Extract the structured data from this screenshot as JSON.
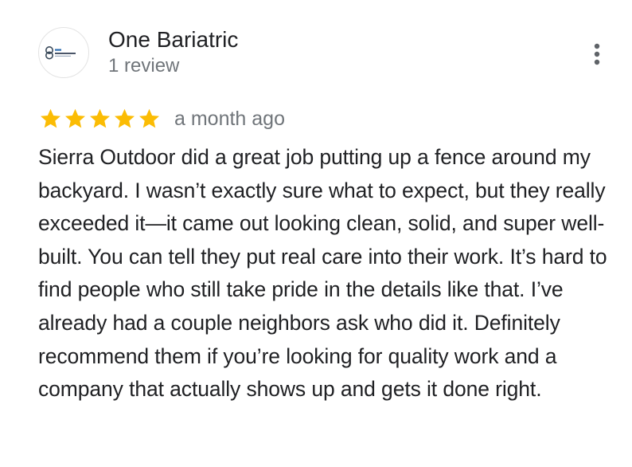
{
  "reviewer": {
    "name": "One Bariatric",
    "review_count": "1 review",
    "avatar_logo_text": "ONE BARIATRIC"
  },
  "rating": {
    "stars": 5,
    "max_stars": 5,
    "star_color": "#fbbc04"
  },
  "review": {
    "date": "a month ago",
    "text": "Sierra Outdoor did a great job putting up a fence around my backyard. I wasn’t exactly sure what to expect, but they really exceeded it—it came out looking clean, solid, and super well-built. You can tell they put real care into their work. It’s hard to find people who still take pride in the details like that. I’ve already had a couple neighbors ask who did it. Definitely recommend them if you’re looking for quality work and a company that actually shows up and gets it done right."
  },
  "icons": {
    "more": "more-vert-icon",
    "star": "star-icon"
  }
}
